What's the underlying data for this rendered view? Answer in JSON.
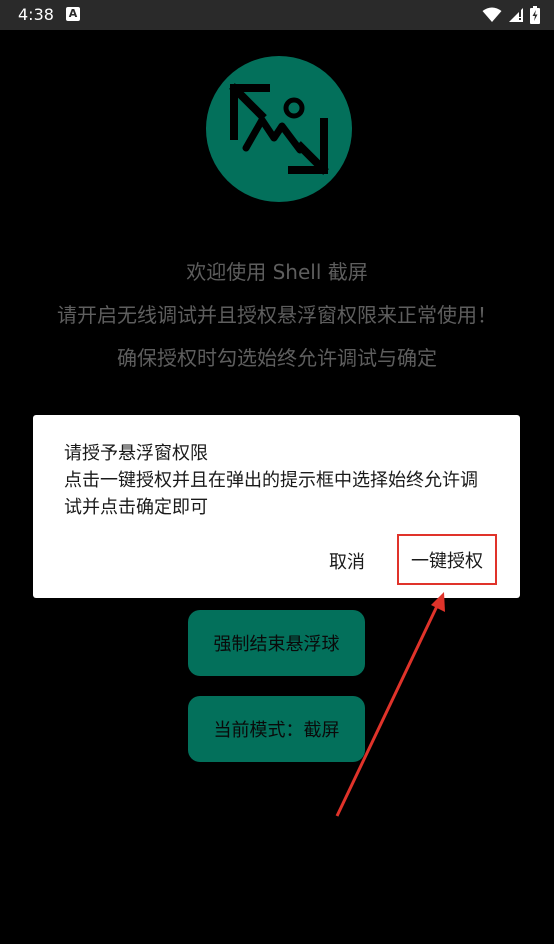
{
  "status_bar": {
    "time": "4:38",
    "notification_icon": "A"
  },
  "intro": {
    "welcome": "欢迎使用 Shell 截屏",
    "instruction": "请开启无线调试并且授权悬浮窗权限来正常使用！",
    "hint": "确保授权时勾选始终允许调试与确定"
  },
  "dialog": {
    "title": "请授予悬浮窗权限",
    "message": "点击一键授权并且在弹出的提示框中选择始终允许调试并点击确定即可",
    "cancel_label": "取消",
    "confirm_label": "一键授权"
  },
  "buttons": {
    "stop_float": "强制结束悬浮球",
    "current_mode": "当前模式：截屏"
  },
  "colors": {
    "accent": "#03705b",
    "highlight": "#e0332a"
  }
}
